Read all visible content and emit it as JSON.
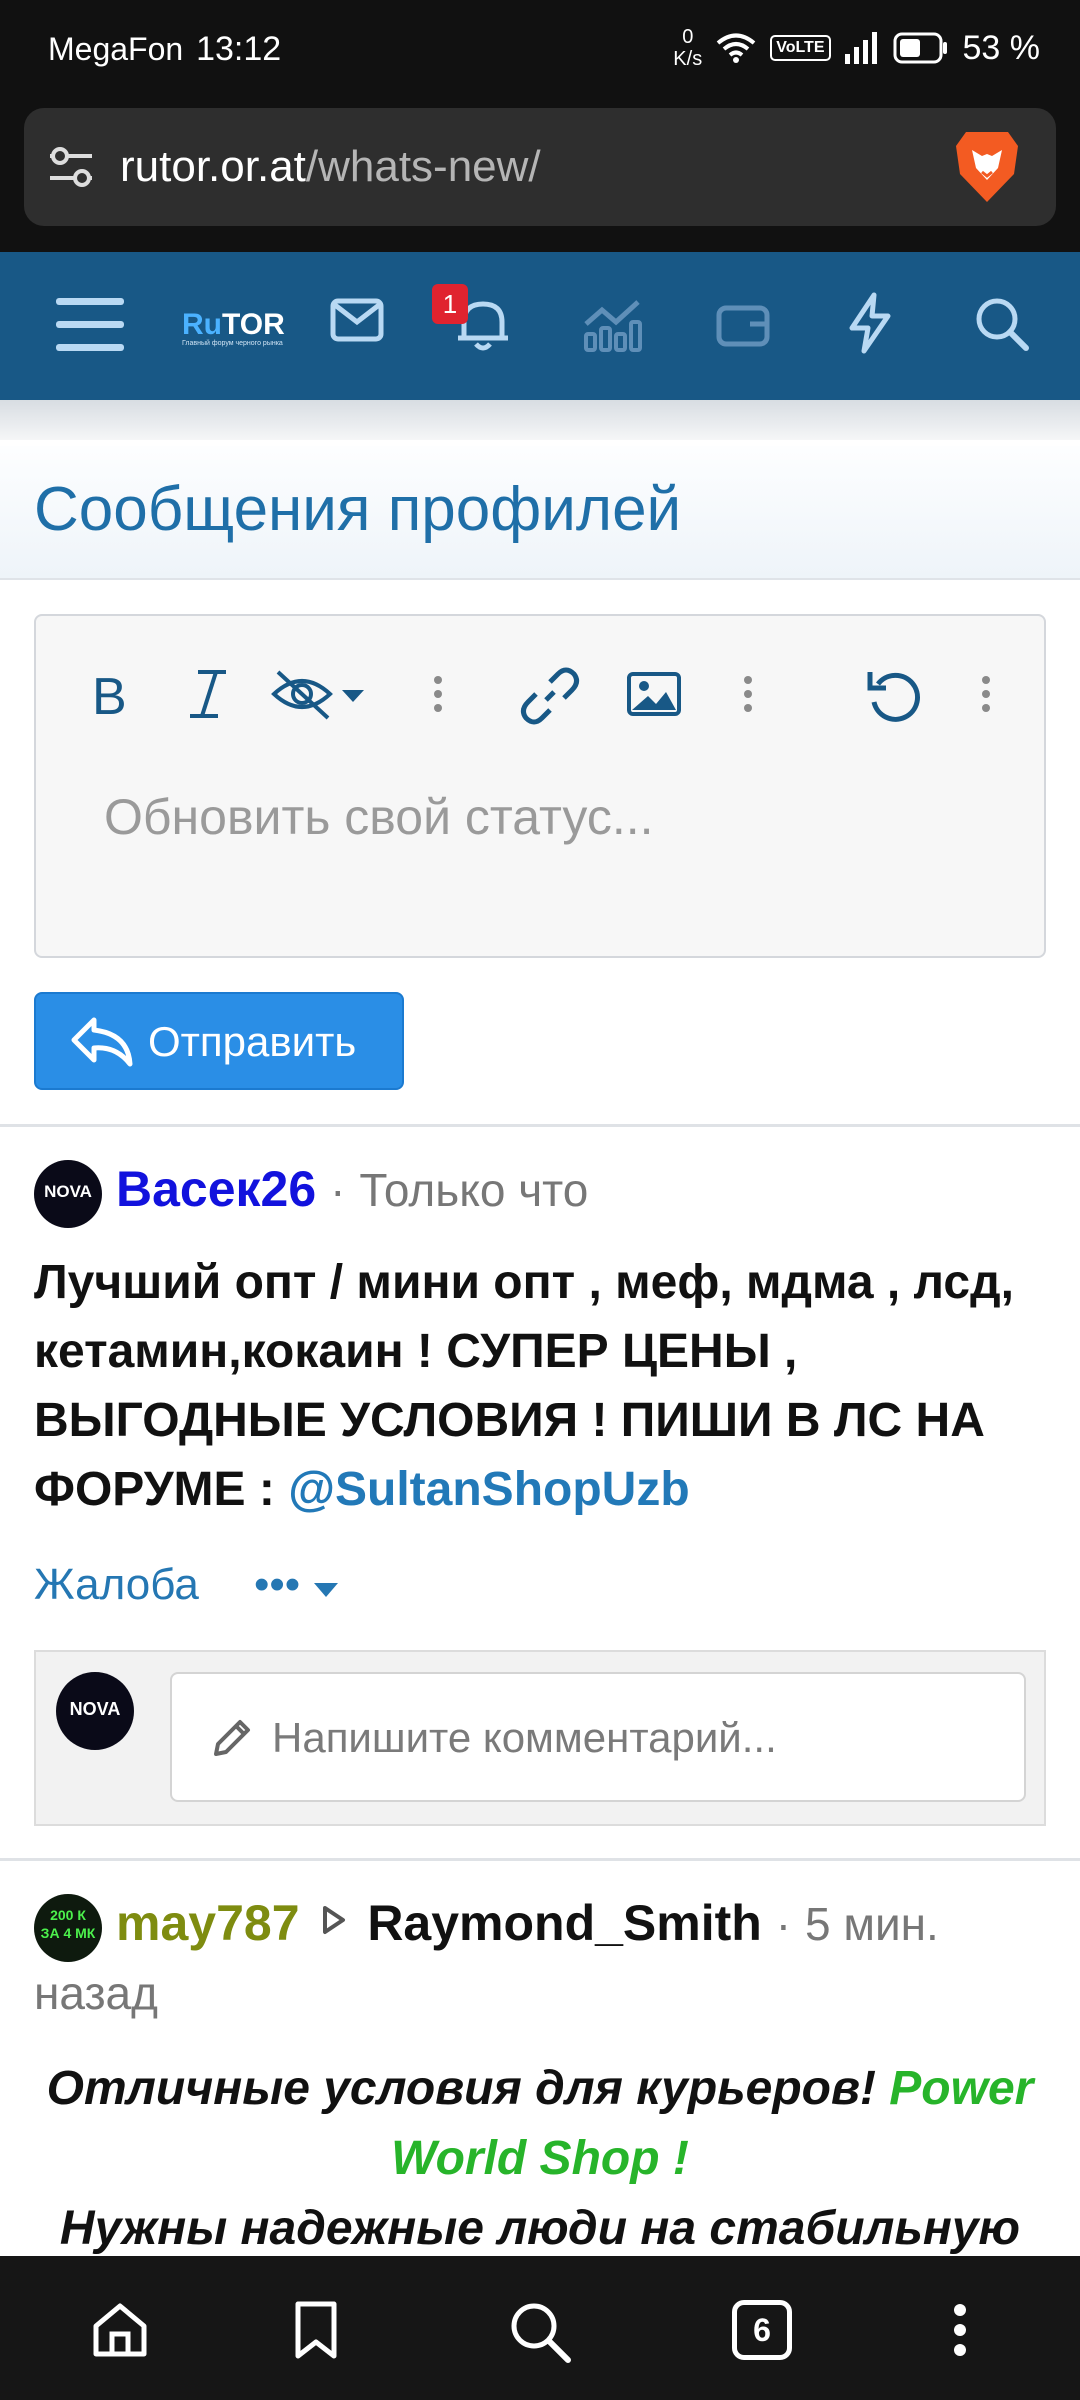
{
  "statusbar": {
    "carrier": "MegaFon",
    "time": "13:12",
    "net_speed_value": "0",
    "net_speed_unit": "K/s",
    "volte": "VoLTE",
    "battery": "53 %"
  },
  "browser": {
    "url_host": "rutor.or.at",
    "url_path": "/whats-new/",
    "tab_count": "6"
  },
  "site": {
    "logo_ru": "Ru",
    "logo_tor": "TOR",
    "logo_tagline": "Главный форум черного рынка",
    "notification_badge": "1"
  },
  "page": {
    "title": "Сообщения профилей"
  },
  "editor": {
    "placeholder": "Обновить свой статус...",
    "submit_label": "Отправить"
  },
  "posts": [
    {
      "author": "Васек26",
      "separator": "·",
      "time": "Только что",
      "avatar_text": "NOVA",
      "body_text": "Лучший опт / мини опт , меф, мдма , лсд, кетамин,кокаин ! СУПЕР ЦЕНЫ , ВЫГОДНЫЕ УСЛОВИЯ ! ПИШИ В ЛС НА ФОРУМЕ : ",
      "body_link": "@SultanShopUzb",
      "report_label": "Жалоба",
      "more_label": "•••",
      "comment_placeholder": "Напишите комментарий..."
    },
    {
      "author": "may787",
      "recipient": "Raymond_Smith",
      "separator": "·",
      "time_line1": "5 мин.",
      "time_line2": "назад",
      "avatar_text": "200 К ЗА 4 МК",
      "body_line1": "Отличные условия для курьеров! ",
      "body_line1_green": "Power",
      "body_line2_green": "World Shop !",
      "body_line3": "Нужны надежные люди на стабильную"
    }
  ],
  "colors": {
    "nav_bg": "#185886",
    "accent_blue": "#2a8ee6",
    "title_blue": "#1f6fa8",
    "username_blue": "#1212dd",
    "username_olive": "#7e8c10",
    "green_text": "#27b42a",
    "badge_red": "#e0232f"
  },
  "icons": [
    "tune-icon",
    "brave-lion-icon",
    "menu-icon",
    "mail-icon",
    "bell-icon",
    "chart-icon",
    "wallet-icon",
    "bolt-icon",
    "search-icon",
    "bold-icon",
    "italic-icon",
    "hide-icon",
    "link-icon",
    "image-icon",
    "undo-icon",
    "reply-icon",
    "pencil-icon",
    "home-icon",
    "bookmark-icon",
    "tabs-icon",
    "kebab-icon"
  ]
}
